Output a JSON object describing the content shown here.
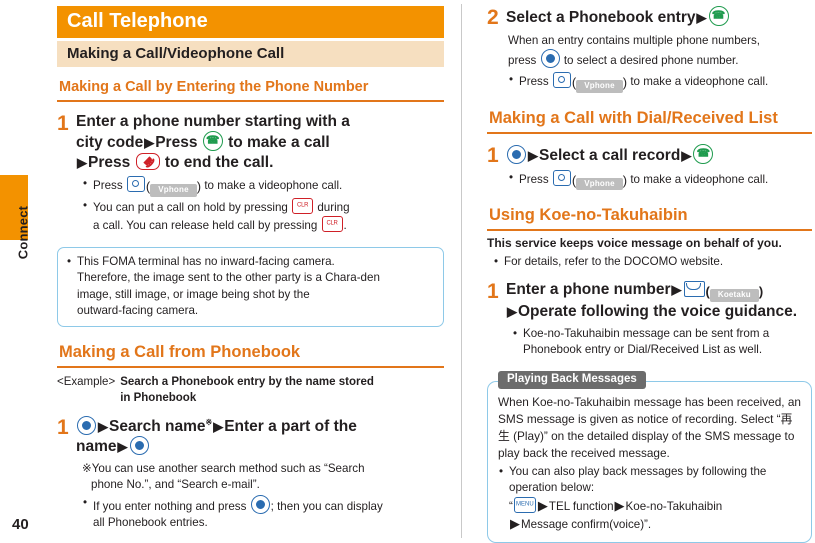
{
  "sidebar": {
    "tab_label": "Connect",
    "page_number": "40"
  },
  "left": {
    "chapter_title": "Call Telephone",
    "section_title": "Making a Call/Videophone Call",
    "subsection_title": "Making a Call by Entering the Phone Number",
    "step1": {
      "num": "1",
      "line1": "Enter a phone number starting with a",
      "line2": "city code",
      "line2b": "Press",
      "line2c": "to make a call",
      "line3a": "Press",
      "line3b": "to end the call.",
      "bullets": [
        "Press (          ) to make a videophone call.",
        "You can put a call on hold by pressing           during a call. You can release held call by pressing           ."
      ],
      "videophone_tag": "Vphone",
      "clr_tag": "CLR"
    },
    "info_box": [
      "This FOMA terminal has no inward-facing camera.",
      "Therefore, the image sent to the other party is a Chara-den",
      "image, still image, or image being shot by the",
      "outward-facing camera."
    ],
    "phonebook_heading": "Making a Call from Phonebook",
    "example_tag": "<Example>",
    "example_text_line1": "Search a Phonebook entry by the name stored",
    "example_text_line2": "in Phonebook",
    "step_pb": {
      "num": "1",
      "part_a": "Search name",
      "ref_mark": "※",
      "part_b": "Enter a part of the",
      "part_c": "name",
      "footnote_line1": "※You can use another search method such as “Search",
      "footnote_line2": "phone No.”, and “Search e-mail”.",
      "bullet_line1": "If you enter nothing and press",
      "bullet_line1b": "; then you can display",
      "bullet_line2": "all Phonebook entries."
    }
  },
  "right": {
    "step2": {
      "num": "2",
      "head": "Select a Phonebook entry",
      "body_line1": "When an entry contains multiple phone numbers,",
      "body_line2a": "press",
      "body_line2b": "to select a desired phone number.",
      "bullet": "Press (          ) to make a videophone call.",
      "videophone_tag": "Vphone"
    },
    "dial_heading": "Making a Call with Dial/Received List",
    "step_dial": {
      "num": "1",
      "head": "Select a call record",
      "bullet": "Press (          ) to make a videophone call.",
      "videophone_tag": "Vphone"
    },
    "koe_heading": "Using Koe-no-Takuhaibin",
    "koe_lead": "This service keeps voice message on behalf of you.",
    "koe_bullet": "For details, refer to the DOCOMO website.",
    "step_koe": {
      "num": "1",
      "head_line1": "Enter a phone number",
      "koetaku_tag": "Koetaku",
      "head_line2": "Operate following the voice guidance.",
      "bullet_line1": "Koe-no-Takuhaibin message can be sent from a",
      "bullet_line2": "Phonebook entry or Dial/Received List as well."
    },
    "callout": {
      "title": "Playing Back Messages",
      "para_line1": "When Koe-no-Takuhaibin message has been received, an",
      "para_line2": "SMS message is given as notice of recording. Select “再生",
      "para_line3": "(Play)” on the detailed display of the SMS message to play",
      "para_line4": "back the received message.",
      "bullet_line1": "You can also play back messages by following the",
      "bullet_line2": "operation below:",
      "bullet_line3a": "“",
      "bullet_line3b": "TEL function",
      "bullet_line3c": "Koe-no-Takuhaibin",
      "bullet_line4": "Message confirm(voice)”.",
      "menu_tag": "MENU"
    }
  },
  "colors": {
    "accent": "#f39200",
    "heading": "#e2761a",
    "section_bg": "#f6dfc0",
    "box_border": "#8ec9e8",
    "callout_title_bg": "#6c6c6c"
  }
}
